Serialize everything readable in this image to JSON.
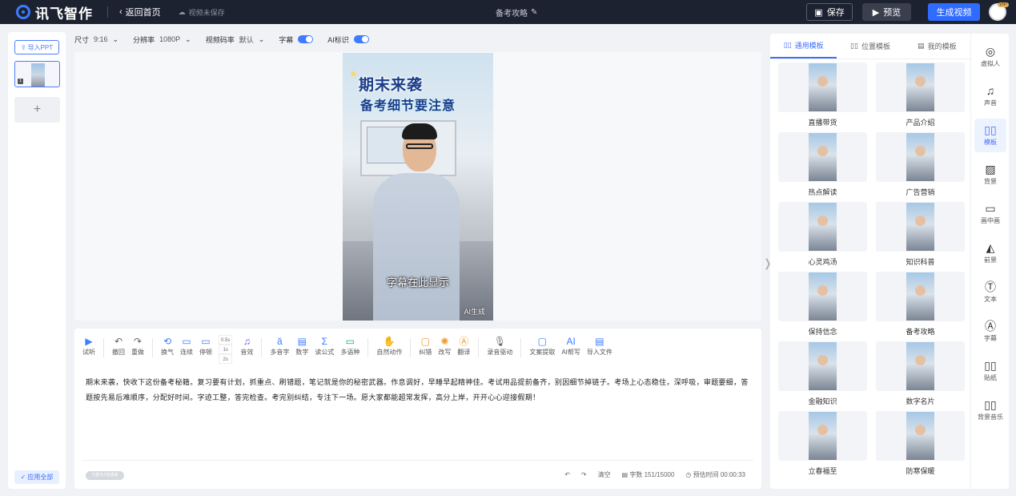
{
  "app": {
    "brand": "讯飞智作",
    "back_label": "返回首页",
    "unsaved_label": "视频未保存",
    "doc_title": "备考攻略"
  },
  "top_actions": {
    "save": "保存",
    "preview": "预览",
    "generate": "生成视频",
    "vip": "VIP"
  },
  "left_panel": {
    "import_ppt": "导入PPT",
    "slide_number": "1",
    "add": "+",
    "apply_all": "应用全部"
  },
  "settings": {
    "size_label": "尺寸",
    "size_value": "9:16",
    "resolution_label": "分辨率",
    "resolution_value": "1080P",
    "bitrate_label": "视频码率",
    "bitrate_value": "默认",
    "subtitle_label": "字幕",
    "ai_label": "AI标识"
  },
  "video": {
    "title_line1": "期末来袭",
    "title_line2": "备考细节要注意",
    "subtitle": "字幕在此显示",
    "ai_mark": "AI生成"
  },
  "toolbar": {
    "listen": "试听",
    "undo": "撤回",
    "redo": "重做",
    "breath": "换气",
    "continuous": "连续",
    "pause": "停顿",
    "speed_options": [
      "0.5s",
      "1s",
      "2s"
    ],
    "sound_effect": "音效",
    "polyphone": "多音字",
    "number": "数字",
    "formula": "读公式",
    "multilang": "多语种",
    "natural_action": "自然动作",
    "correct": "纠错",
    "rewrite": "改写",
    "translate": "翻译",
    "voice_drive": "录音驱动",
    "extract": "文案提取",
    "ai_write": "AI帮写",
    "import_file": "导入文件"
  },
  "script": {
    "text": "期末来袭，快收下这份备考秘籍。复习要有计划，抓重点、刷错题，笔记就是你的秘密武器。作息调好，早睡早起精神佳。考试用品提前备齐，别因细节掉链子。考场上心态稳住，深呼吸，审题要细，答题按先易后难顺序，分配好时间。字迹工整，答完检查。考完别纠结，专注下一场。愿大家都能超常发挥，高分上岸，开开心心迎接假期！"
  },
  "footer": {
    "chip": "只能为2倍语速",
    "clear": "清空",
    "char_count": "字数 151/15000",
    "duration": "预估时间 00:00:33"
  },
  "template_tabs": [
    "通用模板",
    "位置模板",
    "我的模板"
  ],
  "templates": [
    "直播带货",
    "产品介绍",
    "热点解读",
    "广告营销",
    "心灵鸡汤",
    "知识科普",
    "保持信念",
    "备考攻略",
    "金融知识",
    "数字名片",
    "立春福至",
    "防寒保暖"
  ],
  "right_nav": [
    "虚拟人",
    "声音",
    "模板",
    "背景",
    "画中画",
    "前景",
    "文本",
    "字幕",
    "贴纸",
    "背景音乐"
  ],
  "colors": {
    "accent": "#3d6dff",
    "topbar": "#1d2230"
  }
}
